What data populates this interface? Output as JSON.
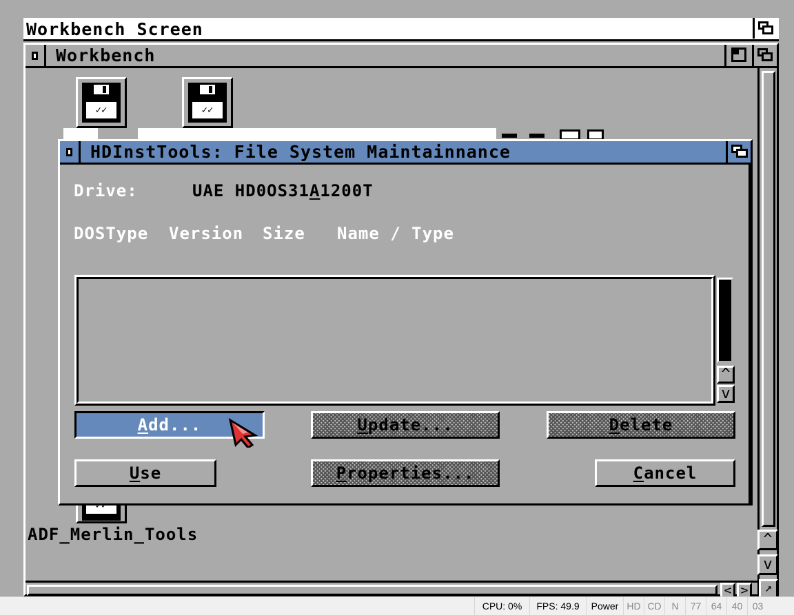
{
  "screen": {
    "title": "Workbench Screen"
  },
  "workbench_window": {
    "title": "Workbench"
  },
  "icons": [
    {
      "caption": ""
    },
    {
      "caption": ""
    },
    {
      "caption": "ADF_Merlin_Tools"
    }
  ],
  "dialog": {
    "title": "HDInstTools: File System Maintainnance",
    "drive_label": "Drive:",
    "drive_value": "UAE HD0OS31",
    "drive_value_mid": "A",
    "drive_value_end": "1200T",
    "columns": [
      "DOSType",
      "Version",
      "Size",
      "Name / Type"
    ],
    "list_items": [],
    "buttons": {
      "add": {
        "hot": "A",
        "rest": "dd...",
        "state": "selected"
      },
      "update": {
        "hot": "U",
        "rest": "pdate...",
        "state": "disabled"
      },
      "delete": {
        "hot": "D",
        "rest": "elete",
        "state": "disabled"
      },
      "use": {
        "hot": "U",
        "rest": "se",
        "state": "enabled"
      },
      "properties": {
        "hot": "P",
        "rest": "roperties...",
        "state": "disabled"
      },
      "cancel": {
        "hot": "C",
        "rest": "ancel",
        "state": "enabled"
      }
    }
  },
  "colors": {
    "workbench_gray": "#aaaaaa",
    "title_blue": "#6689bb",
    "pointer_red": "#dd3333"
  },
  "statusbar": {
    "cpu": "CPU: 0%",
    "fps": "FPS: 49.9",
    "power": "Power",
    "leds": [
      "HD",
      "CD",
      "N",
      "77",
      "64",
      "40",
      "03"
    ]
  }
}
